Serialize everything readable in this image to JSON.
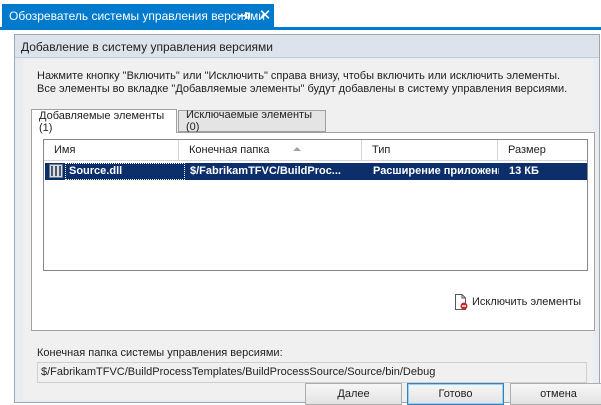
{
  "window_tab": {
    "title": "Обозреватель системы управления версиями",
    "pin_icon": "pin-icon",
    "close_glyph": "✕"
  },
  "dialog": {
    "title": "Добавление в систему управления версиями",
    "intro_line1": "Нажмите кнопку \"Включить\" или \"Исключить\" справа внизу, чтобы включить или исключить элементы.",
    "intro_line2": "Все элементы во вкладке \"Добавляемые элементы\" будут добавлены в систему управления версиями.",
    "tabs": [
      {
        "label": "Добавляемые элементы (1)",
        "active": true
      },
      {
        "label": "Исключаемые элементы (0)",
        "active": false
      }
    ],
    "list": {
      "columns": [
        "Имя",
        "Конечная папка",
        "Тип",
        "Размер"
      ],
      "sort_column": "Конечная папка",
      "rows": [
        {
          "name": "Source.dll",
          "folder": "$/FabrikamTFVC/BuildProc...",
          "type": "Расширение приложения",
          "size": "13 КБ",
          "icon": "dll-file-icon",
          "selected": true
        }
      ]
    },
    "exclude_button": "Исключить элементы",
    "destination_label": "Конечная папка системы управления версиями:",
    "destination_value": "$/FabrikamTFVC/BuildProcessTemplates/BuildProcessSource/Source/bin/Debug",
    "buttons": {
      "next": "Далее",
      "done": "Готово",
      "cancel": "отмена"
    }
  },
  "colors": {
    "accent": "#007acc",
    "selection": "#0c2e6b",
    "dialog_bg": "#f0f0f0"
  }
}
